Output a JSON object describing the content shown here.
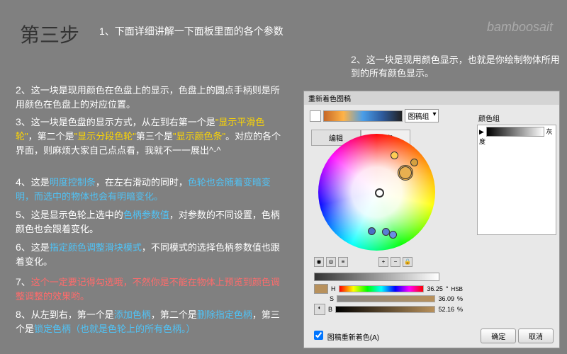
{
  "header": "第三步",
  "subtitle": "1、下面详细讲解一下面板里面的各个参数",
  "watermark": "bamboosait",
  "note2_num": "2、",
  "note2": "这一块是现用颜色显示，也就是你绘制物体所用到的所有颜色显示。",
  "items": [
    {
      "num": "2、",
      "text": "这一块是现用颜色在色盘上的显示，色盘上的圆点手柄则是所用颜色在色盘上的对应位置。"
    },
    {
      "num": "3、",
      "pre": "这一块是色盘的显示方式，从左到右第一个是",
      "h1": "\"显示平滑色轮\"",
      "mid": "，第二个是",
      "h2": "\"显示分段色轮\"",
      "mid2": "第三个是",
      "h3": "\"显示颜色条\"",
      "post": "。对应的各个界面，则麻烦大家自己点点看，我就不一一展出^-^"
    },
    {
      "num": "4、",
      "pre": "这是",
      "h1": "明度控制条",
      "mid": "，在左右滑动的同时，",
      "h2": "色轮也会随着变暗变明，而选中的物体也会有明暗变化。"
    },
    {
      "num": "5、",
      "pre": "这是显示色轮上选中的",
      "h1": "色柄参数值",
      "post": "，对参数的不同设置，色柄颜色也会跟着变化。"
    },
    {
      "num": "6、",
      "pre": "这是",
      "h1": "指定颜色调整滑块模式",
      "post": "，不同模式的选择色柄参数值也跟着变化。"
    },
    {
      "num": "7、",
      "h1": "这个一定要记得勾选哦，不然你是不能在物体上预览到颜色调整调整的效果哟。"
    },
    {
      "num": "8、",
      "pre": "从左到右，第一个是",
      "h1": "添加色柄",
      "mid": "，第二个是",
      "h2": "删除指定色柄",
      "mid2": "，第三个是",
      "h3": "锁定色柄（也就是色轮上的所有色柄。）"
    }
  ],
  "panel": {
    "title": "重新着色图稿",
    "dropdown": "图稿组",
    "tab_edit": "编辑",
    "tab_assign": "指定",
    "side_label": "颜色组",
    "side_gray": "灰度",
    "hsb_h": "H",
    "hsb_s": "S",
    "hsb_b": "B",
    "h_val": "36.25",
    "s_val": "36.09",
    "b_val": "52.16",
    "unit1": "°",
    "unit2": "%",
    "unit3": "%",
    "hsb_mode": "HSB",
    "checkbox": "图稿重新着色(A)",
    "ok": "确定",
    "cancel": "取消"
  }
}
